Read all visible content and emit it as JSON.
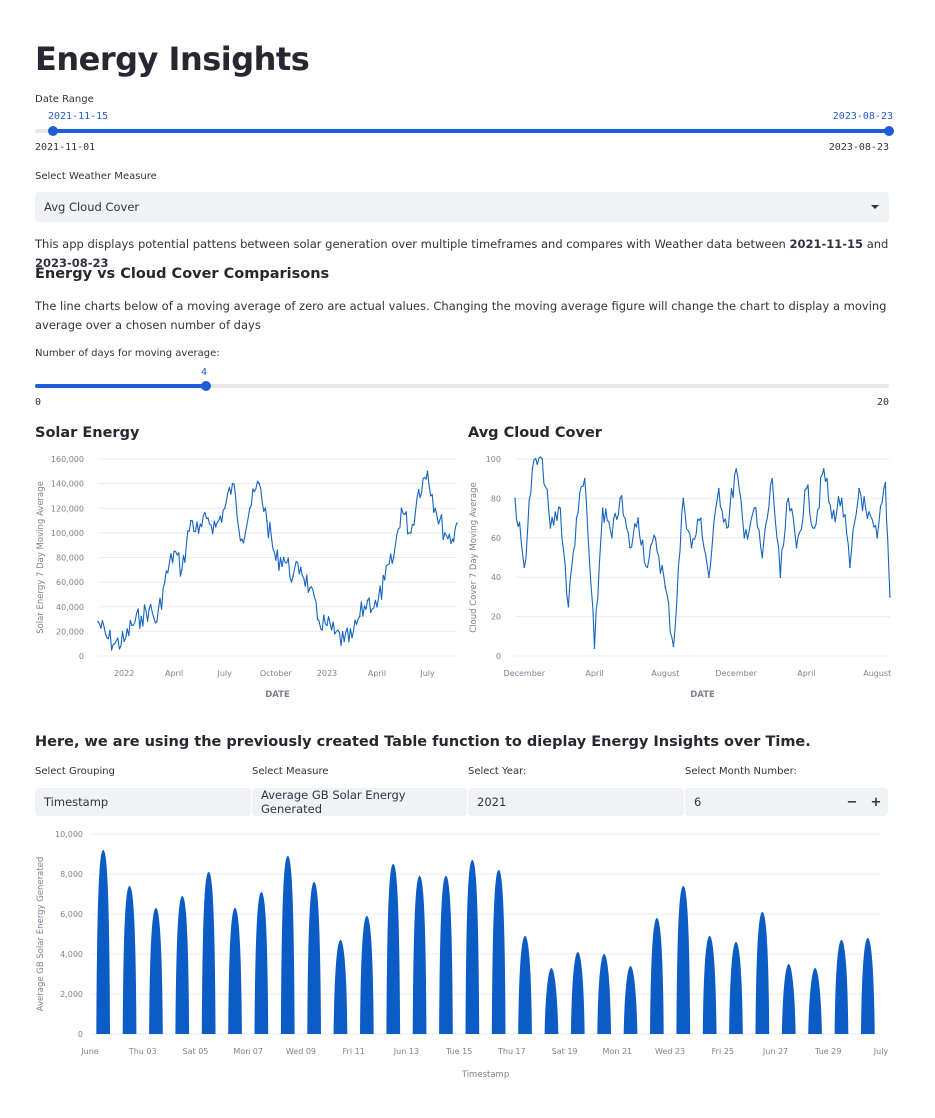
{
  "page": {
    "title": "Energy Insights"
  },
  "date_range": {
    "label": "Date Range",
    "selected_start": "2021-11-15",
    "selected_end": "2023-08-23",
    "min": "2021-11-01",
    "max": "2023-08-23"
  },
  "weather_select": {
    "label": "Select Weather Measure",
    "value": "Avg Cloud Cover"
  },
  "intro": {
    "text": "This app displays potential pattens between solar generation over multiple timeframes and compares with Weather data between ",
    "start": "2021-11-15",
    "and": " and ",
    "end": "2023-08-23"
  },
  "comparison": {
    "heading": "Energy vs Cloud Cover Comparisons",
    "description": "The line charts below of a moving average of zero are actual values. Changing the moving average figure will change the chart to display a moving average over a chosen number of days"
  },
  "moving_avg": {
    "label": "Number of days for moving average:",
    "value": "4",
    "min": "0",
    "max": "20",
    "fraction": 0.2
  },
  "solar_chart": {
    "title": "Solar Energy",
    "ylabel": "Solar Energy 7 Day Moving Average",
    "xlabel": "DATE",
    "yticks": [
      "0",
      "20,000",
      "40,000",
      "60,000",
      "80,000",
      "100,000",
      "120,000",
      "140,000",
      "160,000"
    ],
    "xticks": [
      "2022",
      "April",
      "July",
      "October",
      "2023",
      "April",
      "July"
    ]
  },
  "cloud_chart": {
    "title": "Avg Cloud Cover",
    "ylabel": "Cloud Cover 7 Day Moving Average",
    "xlabel": "DATE",
    "yticks": [
      "0",
      "20",
      "40",
      "60",
      "80",
      "100"
    ],
    "xticks": [
      "December",
      "April",
      "August",
      "December",
      "April",
      "August"
    ]
  },
  "table_section": {
    "heading": "Here, we are using the previously created Table function to dieplay Energy Insights over Time.",
    "grouping": {
      "label": "Select Grouping",
      "value": "Timestamp"
    },
    "measure": {
      "label": "Select Measure",
      "value": "Average GB Solar Energy Generated"
    },
    "year": {
      "label": "Select Year:",
      "value": "2021"
    },
    "month": {
      "label": "Select Month Number:",
      "value": "6",
      "minus": "−",
      "plus": "+"
    }
  },
  "bar_chart": {
    "ylabel": "Average GB Solar Energy Generated",
    "xlabel": "Timestamp",
    "yticks": [
      "0",
      "2,000",
      "4,000",
      "6,000",
      "8,000",
      "10,000"
    ],
    "xticks": [
      "June",
      "Thu 03",
      "Sat 05",
      "Mon 07",
      "Wed 09",
      "Fri 11",
      "Jun 13",
      "Tue 15",
      "Thu 17",
      "Sat 19",
      "Mon 21",
      "Wed 23",
      "Fri 25",
      "Jun 27",
      "Tue 29",
      "July"
    ]
  },
  "colors": {
    "accent": "#1f5ed6",
    "line": "#1565c0",
    "bar": "#0b5cc4",
    "input_bg": "#f0f2f6",
    "grid": "#e9ecef"
  },
  "chart_data": [
    {
      "type": "line",
      "title": "Solar Energy",
      "xlabel": "DATE",
      "ylabel": "Solar Energy 7 Day Moving Average",
      "ylim": [
        0,
        160000
      ],
      "x": [
        "2021-11-15",
        "2021-12-01",
        "2021-12-15",
        "2022-01-01",
        "2022-01-15",
        "2022-02-01",
        "2022-02-15",
        "2022-03-01",
        "2022-03-15",
        "2022-04-01",
        "2022-04-15",
        "2022-05-01",
        "2022-05-15",
        "2022-06-01",
        "2022-06-15",
        "2022-07-01",
        "2022-07-15",
        "2022-08-01",
        "2022-08-15",
        "2022-09-01",
        "2022-09-15",
        "2022-10-01",
        "2022-10-15",
        "2022-11-01",
        "2022-11-15",
        "2022-12-01",
        "2022-12-15",
        "2023-01-01",
        "2023-01-15",
        "2023-02-01",
        "2023-02-15",
        "2023-03-01",
        "2023-03-15",
        "2023-04-01",
        "2023-04-15",
        "2023-05-01",
        "2023-05-15",
        "2023-06-01",
        "2023-06-15",
        "2023-07-01",
        "2023-07-15",
        "2023-08-01",
        "2023-08-15",
        "2023-08-23"
      ],
      "values": [
        28000,
        15000,
        10000,
        12000,
        25000,
        32000,
        38000,
        28000,
        60000,
        85000,
        70000,
        110000,
        100000,
        112000,
        105000,
        120000,
        140000,
        95000,
        120000,
        140000,
        110000,
        78000,
        80000,
        65000,
        72000,
        55000,
        30000,
        25000,
        18000,
        12000,
        15000,
        32000,
        45000,
        40000,
        62000,
        80000,
        120000,
        100000,
        135000,
        150000,
        120000,
        100000,
        95000,
        108000
      ]
    },
    {
      "type": "line",
      "title": "Avg Cloud Cover",
      "xlabel": "DATE",
      "ylabel": "Cloud Cover 7 Day Moving Average",
      "ylim": [
        0,
        100
      ],
      "x": [
        "2021-11-15",
        "2021-12-01",
        "2021-12-15",
        "2022-01-01",
        "2022-01-15",
        "2022-02-01",
        "2022-02-15",
        "2022-03-01",
        "2022-03-15",
        "2022-04-01",
        "2022-04-15",
        "2022-05-01",
        "2022-05-15",
        "2022-06-01",
        "2022-06-15",
        "2022-07-01",
        "2022-07-15",
        "2022-08-01",
        "2022-08-15",
        "2022-09-01",
        "2022-09-15",
        "2022-10-01",
        "2022-10-15",
        "2022-11-01",
        "2022-11-15",
        "2022-12-01",
        "2022-12-15",
        "2023-01-01",
        "2023-01-15",
        "2023-02-01",
        "2023-02-15",
        "2023-03-01",
        "2023-03-15",
        "2023-04-01",
        "2023-04-15",
        "2023-05-01",
        "2023-05-15",
        "2023-06-01",
        "2023-06-15",
        "2023-07-01",
        "2023-07-15",
        "2023-08-01",
        "2023-08-15",
        "2023-08-23"
      ],
      "values": [
        80,
        45,
        95,
        100,
        65,
        75,
        25,
        70,
        90,
        4,
        75,
        60,
        80,
        55,
        70,
        45,
        60,
        35,
        5,
        80,
        55,
        70,
        40,
        85,
        65,
        95,
        60,
        75,
        50,
        90,
        40,
        80,
        55,
        85,
        65,
        95,
        70,
        80,
        45,
        85,
        70,
        60,
        88,
        30
      ]
    },
    {
      "type": "bar",
      "xlabel": "Timestamp",
      "ylabel": "Average GB Solar Energy Generated",
      "ylim": [
        0,
        10000
      ],
      "categories": [
        "Jun 01",
        "Jun 02",
        "Jun 03",
        "Jun 04",
        "Jun 05",
        "Jun 06",
        "Jun 07",
        "Jun 08",
        "Jun 09",
        "Jun 10",
        "Jun 11",
        "Jun 12",
        "Jun 13",
        "Jun 14",
        "Jun 15",
        "Jun 16",
        "Jun 17",
        "Jun 18",
        "Jun 19",
        "Jun 20",
        "Jun 21",
        "Jun 22",
        "Jun 23",
        "Jun 24",
        "Jun 25",
        "Jun 26",
        "Jun 27",
        "Jun 28",
        "Jun 29",
        "Jun 30"
      ],
      "values": [
        9200,
        7400,
        6300,
        6900,
        8100,
        6300,
        7100,
        8900,
        7600,
        4700,
        5900,
        8500,
        7900,
        7900,
        8700,
        8200,
        4900,
        3300,
        4100,
        4000,
        3400,
        5800,
        7400,
        4900,
        4600,
        6100,
        3500,
        3300,
        4700,
        4800
      ]
    }
  ]
}
